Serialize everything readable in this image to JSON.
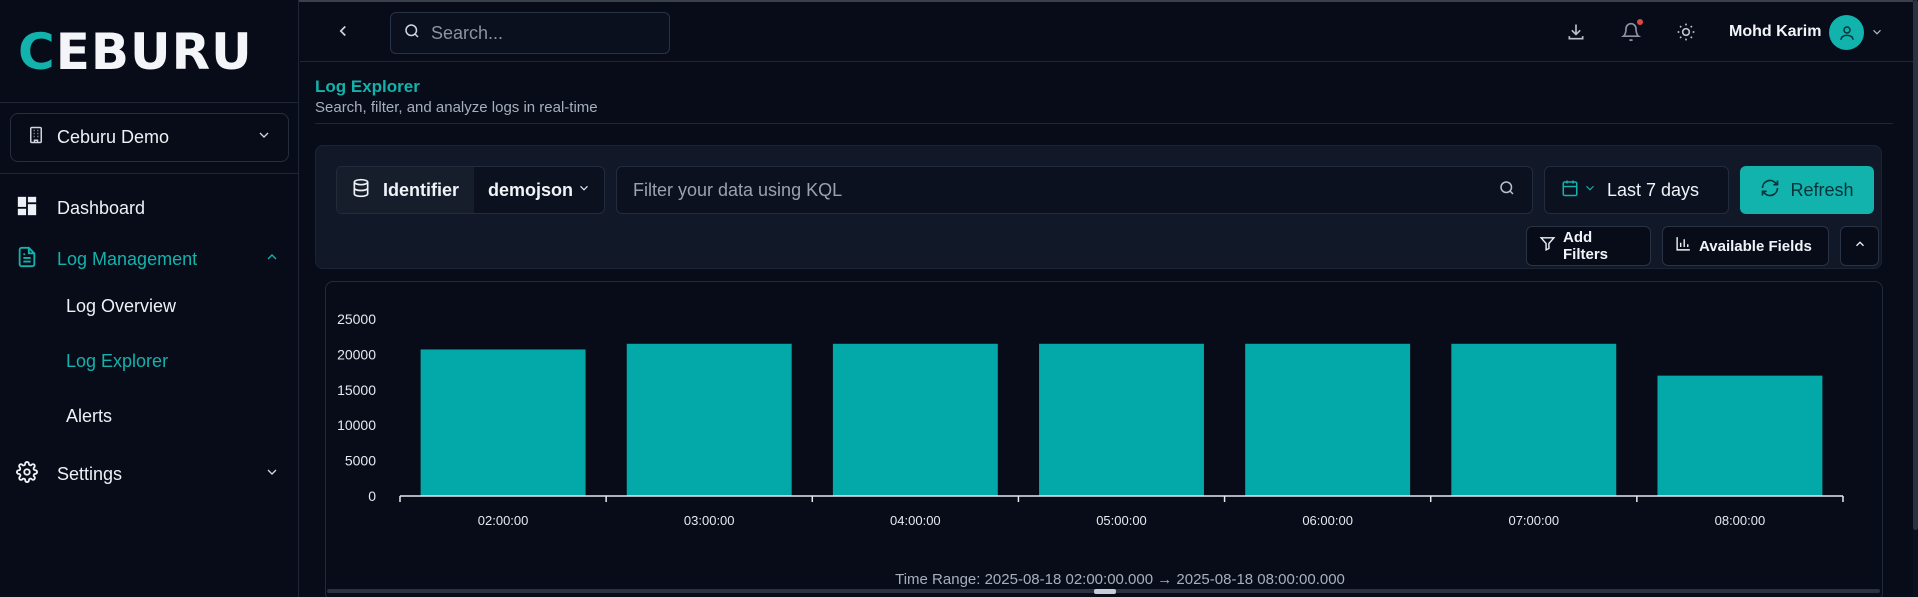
{
  "brand": {
    "logo_first": "C",
    "logo_rest": "EBURU",
    "accent": "#12b3ad"
  },
  "org": {
    "name": "Ceburu Demo"
  },
  "nav": {
    "dashboard": "Dashboard",
    "log_management": "Log Management",
    "log_overview": "Log Overview",
    "log_explorer": "Log Explorer",
    "alerts": "Alerts",
    "settings": "Settings"
  },
  "topbar": {
    "search_placeholder": "Search...",
    "user_name": "Mohd Karim"
  },
  "page": {
    "title": "Log Explorer",
    "subtitle": "Search, filter, and analyze logs in real-time"
  },
  "filters": {
    "identifier_label": "Identifier",
    "identifier_value": "demojson",
    "kql_placeholder": "Filter your data using KQL",
    "time_range": "Last 7 days",
    "refresh_label": "Refresh",
    "add_filters_label": "Add Filters",
    "available_fields_label": "Available Fields"
  },
  "chart_data": {
    "type": "bar",
    "categories": [
      "02:00:00",
      "03:00:00",
      "04:00:00",
      "05:00:00",
      "06:00:00",
      "07:00:00",
      "08:00:00"
    ],
    "values": [
      20700,
      21500,
      21500,
      21500,
      21500,
      21500,
      17000
    ],
    "yticks": [
      0,
      5000,
      10000,
      15000,
      20000,
      25000
    ],
    "ylim": [
      0,
      25000
    ],
    "bar_color": "#03a9a9",
    "footer": "Time Range: 2025-08-18 02:00:00.000 → 2025-08-18 08:00:00.000"
  }
}
